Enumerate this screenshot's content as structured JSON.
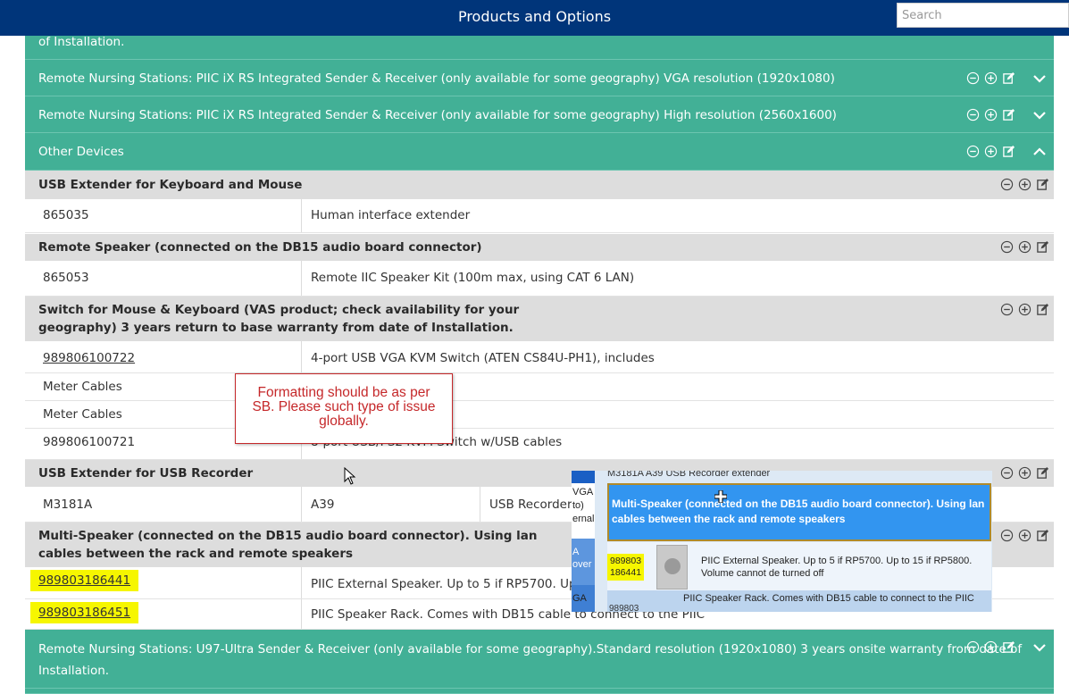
{
  "header": {
    "title": "Products and Options",
    "search_placeholder": "Search"
  },
  "groups": [
    {
      "title": "of Installation.",
      "expanded": false
    },
    {
      "title": "Remote Nursing Stations: PIIC iX RS Integrated Sender & Receiver (only available for some geography) VGA resolution (1920x1080)",
      "expanded": false
    },
    {
      "title": "Remote Nursing Stations: PIIC iX RS Integrated Sender & Receiver (only available for some geography) High resolution (2560x1600)",
      "expanded": false
    },
    {
      "title": "Other Devices",
      "expanded": true
    }
  ],
  "sections": [
    {
      "title": "USB Extender for Keyboard and Mouse"
    },
    {
      "title": "Remote Speaker (connected on the DB15 audio board connector)"
    },
    {
      "title_line1": "Switch for Mouse & Keyboard (VAS product; check availability for your",
      "title_line2": "geography) 3 years return to base warranty from date of Installation."
    },
    {
      "title": "USB Extender for USB Recorder"
    },
    {
      "title_line1": "Multi-Speaker (connected on the DB15 audio board connector). Using lan",
      "title_line2": "cables between the rack and remote speakers"
    }
  ],
  "rows": {
    "usb_ext": {
      "code": "865035",
      "desc": "Human interface extender"
    },
    "speaker": {
      "code": "865053",
      "desc": "Remote IIC Speaker Kit (100m max, using CAT 6 LAN)"
    },
    "kvm1": {
      "code": "989806100722",
      "desc": "4-port USB VGA KVM Switch (ATEN CS84U-PH1), includes"
    },
    "kvm2": {
      "code": "Meter Cables"
    },
    "kvm3": {
      "code": "Meter Cables"
    },
    "kvm4": {
      "code": "989806100721",
      "desc": "8-port USB/PS2 KVM Switch w/USB cables"
    },
    "rec": {
      "code": "M3181A",
      "option": "A39",
      "desc": "USB Recorder"
    },
    "multi1": {
      "code": "989803186441",
      "desc": "PIIC External Speaker. Up to 5 if RP5700. Up to 1"
    },
    "multi2": {
      "code": "989803186451",
      "desc": "PIIC Speaker Rack. Comes with DB15 cable to connect to the PIIC"
    }
  },
  "bottom_group": {
    "line1": "Remote Nursing Stations: U97-Ultra Sender & Receiver (only available for some geography).Standard resolution (1920x1080) 3 years onsite warranty from date of",
    "line2": "Installation."
  },
  "callout": {
    "line1": "Formatting should be as per",
    "line2": "SB. Please such type of issue",
    "line3": "globally."
  },
  "overlay": {
    "top_text": "M3181A       A39        USB Recorder  extender",
    "strip_1": "VGA",
    "strip_2": "to)",
    "strip_3": "ernal",
    "strip_4": "A",
    "strip_5": "over",
    "strip_6": "GA",
    "highlight_line1": "Multi-Speaker (connected on the DB15 audio board connector). Using lan",
    "highlight_line2": "cables between the rack and remote speakers",
    "num_line1": "989803",
    "num_line2": "186441",
    "desc_line1": "PIIC External Speaker. Up to 5 if RP5700. Up to 15 if RP5800.",
    "desc_line2": "Volume cannot de turned off",
    "rack_text": "PIIC Speaker Rack. Comes with DB15 cable to connect to the PIIC",
    "rack_num": "989803"
  },
  "colors": {
    "header_bg": "#00357a",
    "group_bg": "#42b096",
    "section_bg": "#dddddd",
    "highlight": "#f6f600",
    "callout": "#c5282a"
  },
  "icons": [
    "minus-circle-icon",
    "plus-circle-icon",
    "edit-icon",
    "chevron-down-icon",
    "chevron-up-icon"
  ]
}
